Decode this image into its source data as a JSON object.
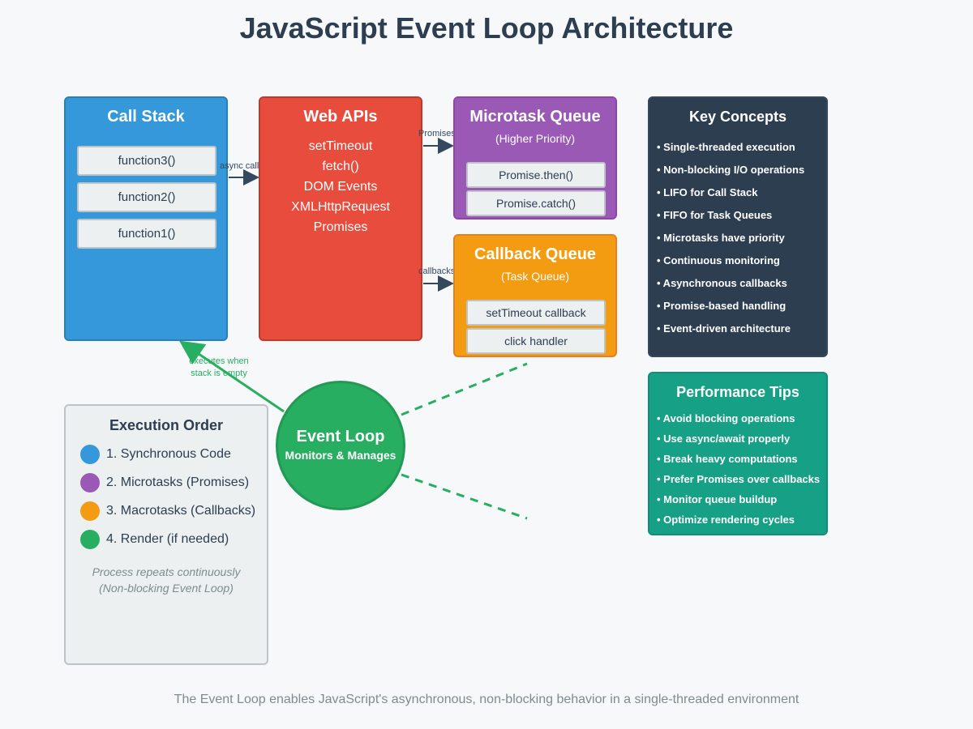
{
  "title": "JavaScript Event Loop Architecture",
  "colors": {
    "call_stack": "#3498db",
    "web_apis": "#e74c3c",
    "microtask": "#9b59b6",
    "callback": "#f39c12",
    "event_loop": "#27ae60",
    "key_concepts": "#2c3e50",
    "perf_tips": "#16a085"
  },
  "call_stack": {
    "title": "Call Stack",
    "items": [
      "function3()",
      "function2()",
      "function1()"
    ]
  },
  "web_apis": {
    "title": "Web APIs",
    "items": [
      "setTimeout",
      "fetch()",
      "DOM Events",
      "XMLHttpRequest",
      "Promises"
    ]
  },
  "microtask_queue": {
    "title": "Microtask Queue",
    "subtitle": "(Higher Priority)",
    "items": [
      "Promise.then()",
      "Promise.catch()"
    ]
  },
  "callback_queue": {
    "title": "Callback Queue",
    "subtitle": "(Task Queue)",
    "items": [
      "setTimeout callback",
      "click handler"
    ]
  },
  "arrows": {
    "async_calls": "async calls",
    "promises": "Promises",
    "callbacks": "callbacks",
    "executes_line1": "executes when",
    "executes_line2": "stack is empty"
  },
  "event_loop": {
    "title": "Event Loop",
    "subtitle": "Monitors & Manages"
  },
  "key_concepts": {
    "title": "Key Concepts",
    "items": [
      "• Single-threaded execution",
      "• Non-blocking I/O operations",
      "• LIFO for Call Stack",
      "• FIFO for Task Queues",
      "• Microtasks have priority",
      "• Continuous monitoring",
      "• Asynchronous callbacks",
      "• Promise-based handling",
      "• Event-driven architecture"
    ]
  },
  "performance_tips": {
    "title": "Performance Tips",
    "items": [
      "• Avoid blocking operations",
      "• Use async/await properly",
      "• Break heavy computations",
      "• Prefer Promises over callbacks",
      "• Monitor queue buildup",
      "• Optimize rendering cycles"
    ]
  },
  "execution_order": {
    "title": "Execution Order",
    "items": [
      {
        "label": "1. Synchronous Code",
        "color": "#3498db"
      },
      {
        "label": "2. Microtasks (Promises)",
        "color": "#9b59b6"
      },
      {
        "label": "3. Macrotasks (Callbacks)",
        "color": "#f39c12"
      },
      {
        "label": "4. Render (if needed)",
        "color": "#27ae60"
      }
    ],
    "note_line1": "Process repeats continuously",
    "note_line2": "(Non-blocking Event Loop)"
  },
  "footer": "The Event Loop enables JavaScript's asynchronous, non-blocking behavior in a single-threaded environment"
}
